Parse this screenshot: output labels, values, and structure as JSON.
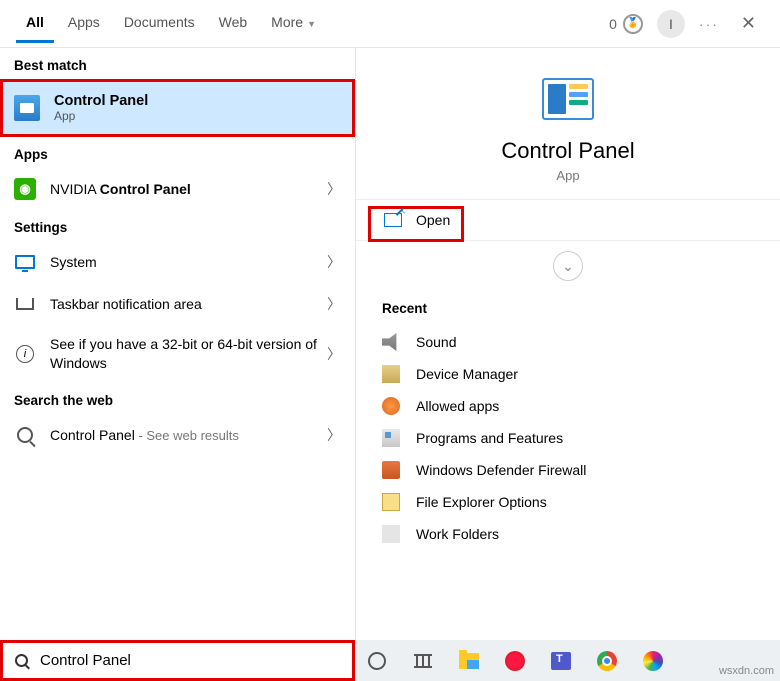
{
  "header": {
    "tabs": {
      "all": "All",
      "apps": "Apps",
      "documents": "Documents",
      "web": "Web",
      "more": "More"
    },
    "points": "0",
    "user_initial": "I"
  },
  "left": {
    "best_match": "Best match",
    "best": {
      "title": "Control Panel",
      "sub": "App"
    },
    "apps_hdr": "Apps",
    "nvidia_pre": "NVIDIA ",
    "nvidia_bold": "Control Panel",
    "settings_hdr": "Settings",
    "system": "System",
    "taskbar": "Taskbar notification area",
    "bits": "See if you have a 32-bit or 64-bit version of Windows",
    "search_web_hdr": "Search the web",
    "web_term": "Control Panel",
    "web_suffix": " - See web results"
  },
  "right": {
    "title": "Control Panel",
    "sub": "App",
    "open": "Open",
    "recent": "Recent",
    "items": {
      "sound": "Sound",
      "dm": "Device Manager",
      "allowed": "Allowed apps",
      "pf": "Programs and Features",
      "wdf": "Windows Defender Firewall",
      "feo": "File Explorer Options",
      "wf": "Work Folders"
    }
  },
  "search": "Control Panel",
  "watermark": "wsxdn.com"
}
